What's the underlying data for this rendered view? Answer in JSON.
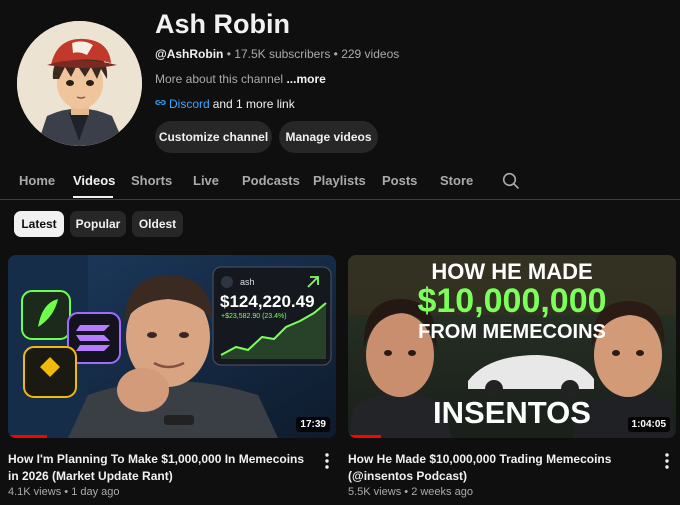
{
  "channel": {
    "name": "Ash Robin",
    "handle": "@AshRobin",
    "subscribers": "17.5K subscribers",
    "videos_count": "229 videos",
    "separator": "•",
    "about": "More about this channel",
    "more_label": "...more",
    "link_primary": "Discord",
    "link_more": "and 1 more link"
  },
  "actions": {
    "customize": "Customize channel",
    "manage": "Manage videos"
  },
  "tabs": [
    {
      "label": "Home"
    },
    {
      "label": "Videos",
      "active": true
    },
    {
      "label": "Shorts"
    },
    {
      "label": "Live"
    },
    {
      "label": "Podcasts"
    },
    {
      "label": "Playlists"
    },
    {
      "label": "Posts"
    },
    {
      "label": "Store"
    }
  ],
  "filters": [
    {
      "label": "Latest",
      "active": true
    },
    {
      "label": "Popular"
    },
    {
      "label": "Oldest"
    }
  ],
  "videos": [
    {
      "title": "How I'm Planning To Make $1,000,000 In Memecoins in 2026 (Market Update Rant)",
      "views": "4.1K views",
      "age": "1 day ago",
      "duration": "17:39",
      "progress": 0.12,
      "thumb": {
        "wallet_user": "ash",
        "wallet_balance": "$124,220.49",
        "wallet_change": "+$23,582.90 (23.4%)"
      }
    },
    {
      "title": "How He Made $10,000,000 Trading Memecoins (@insentos Podcast)",
      "views": "5.5K views",
      "age": "2 weeks ago",
      "duration": "1:04:05",
      "progress": 0.1,
      "thumb": {
        "line1": "HOW HE MADE",
        "line2": "$10,000,000",
        "line3": "FROM MEMECOINS",
        "name": "INSENTOS"
      }
    }
  ],
  "colors": {
    "background": "#0f0f0f",
    "link": "#3ea6ff",
    "accent_green": "#7cff5a",
    "progress_red": "#ff0000"
  },
  "icons": [
    "link-icon",
    "search-icon",
    "kebab-menu-icon"
  ]
}
